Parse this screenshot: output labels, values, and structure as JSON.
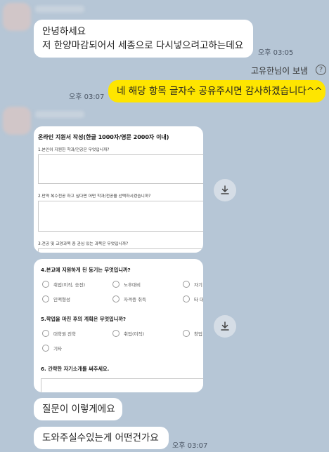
{
  "messages": {
    "first_greeting": "안녕하세요\n저 한양마감되어서 세종으로 다시넣으려고하는데요",
    "first_time": "오후 03:05",
    "read_note": "고유한님이 보냄",
    "help_glyph": "?",
    "my_message": "네 해당 항목 글자수 공유주시면 감사하겠습니다^^",
    "my_time": "오후 03:07",
    "question_text": "질문이 이렇게에요",
    "help_text": "도와주실수있는게 어떤건가요",
    "last_time": "오후 03:07"
  },
  "form1": {
    "title": "온라인 지원서 작성(한글 1000자/영문 2000자 이내)",
    "q1": "1.본인이 지원한 학과/전공은 무엇입니까?",
    "q2": "2.만약 복수전공 하고 싶다면 어떤 학과/전공을 선택하시겠습니까?",
    "q3": "3.전공 및 교양과목 중 관심 있는 과목은 무엇입니까?"
  },
  "form2": {
    "q4": "4.본교에 지원하게 된 동기는 무엇입니까?",
    "q4_options": [
      "취업(이직, 승진)",
      "노후대비",
      "자기",
      "인맥형성",
      "자격증 취득",
      "타 대"
    ],
    "q5": "5.학업을 마친 후의 계획은 무엇입니까?",
    "q5_options": [
      "대학원 진학",
      "취업(이직)",
      "창업",
      "기타"
    ],
    "q6": "6. 간략한 자기소개를 써주세요."
  },
  "icons": {
    "download": "download-icon",
    "help": "help-icon"
  },
  "colors": {
    "background": "#b6c6d6",
    "my_bubble": "#fee500",
    "their_bubble": "#ffffff"
  }
}
